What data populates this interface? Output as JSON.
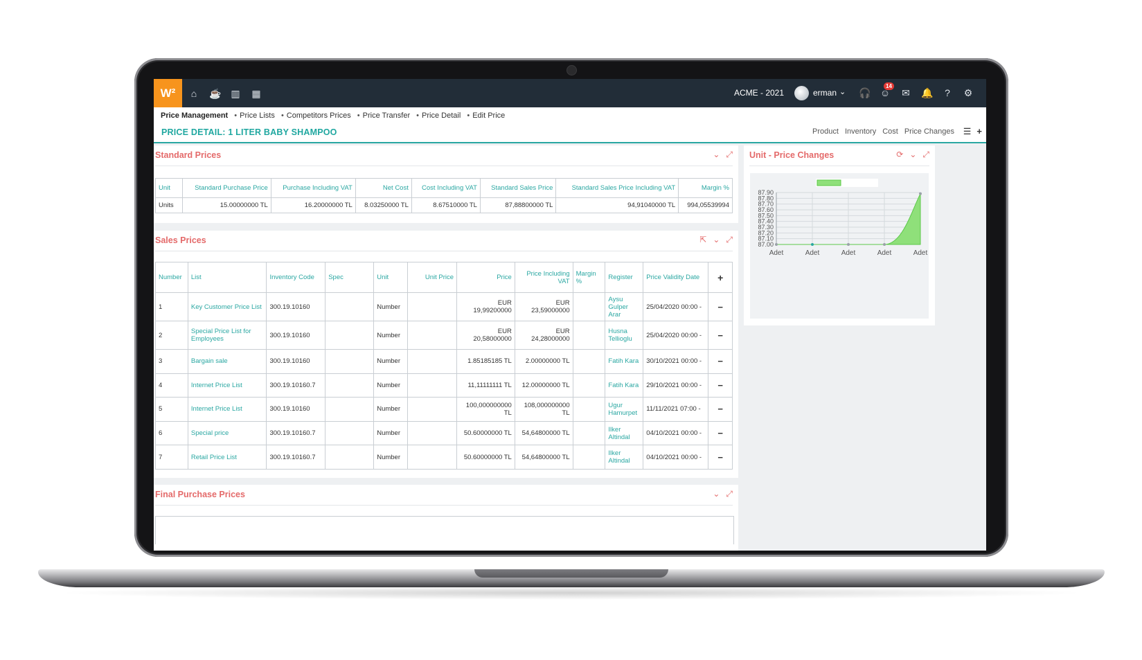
{
  "topbar": {
    "logo": "W²",
    "company": "ACME - 2021",
    "username": "erman",
    "notification_count": "14"
  },
  "breadcrumb": [
    "Price Management",
    "Price Lists",
    "Competitors Prices",
    "Price Transfer",
    "Price Detail",
    "Edit Price"
  ],
  "page": {
    "title": "PRICE DETAIL: 1 LITER BABY SHAMPOO",
    "links": [
      "Product",
      "Inventory",
      "Cost",
      "Price Changes"
    ]
  },
  "standard_prices": {
    "title": "Standard Prices",
    "headers": [
      "Unit",
      "Standard Purchase Price",
      "Purchase Including VAT",
      "Net Cost",
      "Cost Including VAT",
      "Standard Sales Price",
      "Standard Sales Price Including VAT",
      "Margin %"
    ],
    "rows": [
      [
        "Units",
        "15.00000000 TL",
        "16.20000000 TL",
        "8.03250000 TL",
        "8.67510000 TL",
        "87,88800000 TL",
        "94,91040000 TL",
        "994,05539994"
      ]
    ]
  },
  "sales_prices": {
    "title": "Sales Prices",
    "headers": [
      "Number",
      "List",
      "Inventory Code",
      "Spec",
      "Unit",
      "Unit Price",
      "Price",
      "Price Including VAT",
      "Margin %",
      "Register",
      "Price Validity Date"
    ],
    "rows": [
      [
        "1",
        "Key Customer Price List",
        "300.19.10160",
        "",
        "Number",
        "",
        "EUR 19,99200000",
        "EUR 23,59000000",
        "",
        "Aysu Gulper Arar",
        "25/04/2020 00:00 -"
      ],
      [
        "2",
        "Special Price List for Employees",
        "300.19.10160",
        "",
        "Number",
        "",
        "EUR 20,58000000",
        "EUR 24,28000000",
        "",
        "Husna Tellioglu",
        "25/04/2020 00:00 -"
      ],
      [
        "3",
        "Bargain sale",
        "300.19.10160",
        "",
        "Number",
        "",
        "1.85185185 TL",
        "2.00000000 TL",
        "",
        "Fatih Kara",
        "30/10/2021 00:00 -"
      ],
      [
        "4",
        "Internet Price List",
        "300.19.10160.7",
        "",
        "Number",
        "",
        "11,11111111 TL",
        "12.00000000 TL",
        "",
        "Fatih Kara",
        "29/10/2021 00:00 -"
      ],
      [
        "5",
        "Internet Price List",
        "300.19.10160",
        "",
        "Number",
        "",
        "100,000000000 TL",
        "108,000000000 TL",
        "",
        "Ugur Hamurpet",
        "11/11/2021 07:00 -"
      ],
      [
        "6",
        "Special price",
        "300.19.10160.7",
        "",
        "Number",
        "",
        "50.60000000 TL",
        "54,64800000 TL",
        "",
        "Ilker Altindal",
        "04/10/2021 00:00 -"
      ],
      [
        "7",
        "Retail Price List",
        "300.19.10160.7",
        "",
        "Number",
        "",
        "50.60000000 TL",
        "54,64800000 TL",
        "",
        "Ilker Altindal",
        "04/10/2021 00:00 -"
      ]
    ]
  },
  "final_purchase_prices": {
    "title": "Final Purchase Prices"
  },
  "unit_price_changes": {
    "title": "Unit - Price Changes"
  },
  "chart_data": {
    "type": "area",
    "x": [
      "Adet",
      "Adet",
      "Adet",
      "Adet",
      "Adet"
    ],
    "values": [
      87.0,
      87.0,
      87.0,
      87.0,
      87.88
    ],
    "yticks": [
      "87.90",
      "87.80",
      "87.70",
      "87.60",
      "87.50",
      "87.40",
      "87.30",
      "87.20",
      "87.10",
      "87.00"
    ],
    "ylim": [
      87.0,
      87.9
    ],
    "grid": true,
    "legend": "top-center",
    "colors": {
      "fill": "#8fe07a",
      "line": "#5cc84a"
    }
  },
  "colors": {
    "accent": "#2aa7a2",
    "panel_title": "#e46a6a",
    "logo": "#f7941d",
    "topbar": "#222d38"
  }
}
